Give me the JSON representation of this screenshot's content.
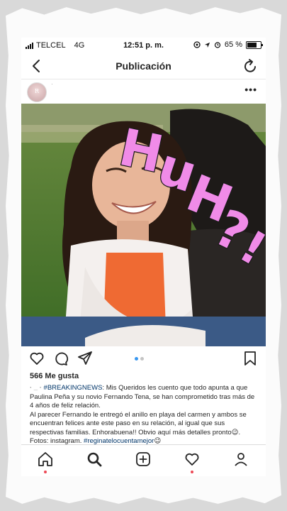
{
  "status_bar": {
    "carrier": "TELCEL",
    "network": "4G",
    "time": "12:51 p. m.",
    "battery": "65 %"
  },
  "nav": {
    "title": "Publicación",
    "back_icon": "chevron-left-icon",
    "refresh_icon": "refresh-icon"
  },
  "post": {
    "avatar_letter": "R",
    "username": "·",
    "more_icon": "more-dots-icon",
    "sticker_text": "HUH?!",
    "likes": "566 Me gusta",
    "caption": {
      "username": "· _ ·",
      "hashtag": "#BREAKINGNEWS",
      "text1": ": Mis Queridos les cuento que todo apunta a que Paulina Peña y su novio Fernando Tena, se han comprometido tras más de 4 años de feliz relación.",
      "text2": "Al parecer Fernando le entregó el anillo en playa del carmen y ambos se encuentran felices ante este paso en su relación, al igual que sus respectivas familias. Enhorabuena!! Obvio aquí más detalles pronto",
      "emoji1": "😉",
      "text3": ". Fotos: instagram. ",
      "hashtag2": "#reginatelocuentamejor",
      "emoji2": "😉"
    },
    "carousel": {
      "count": 2,
      "active": 1
    }
  },
  "colors": {
    "sticker": "#f08be8",
    "sticker_outline": "#1a1a1a",
    "link": "#003569",
    "carousel_active": "#3897f0",
    "notification_dot": "#ed4956"
  },
  "tabbar": {
    "items": [
      "home-icon",
      "search-icon",
      "new-post-icon",
      "activity-heart-icon",
      "profile-icon"
    ]
  }
}
